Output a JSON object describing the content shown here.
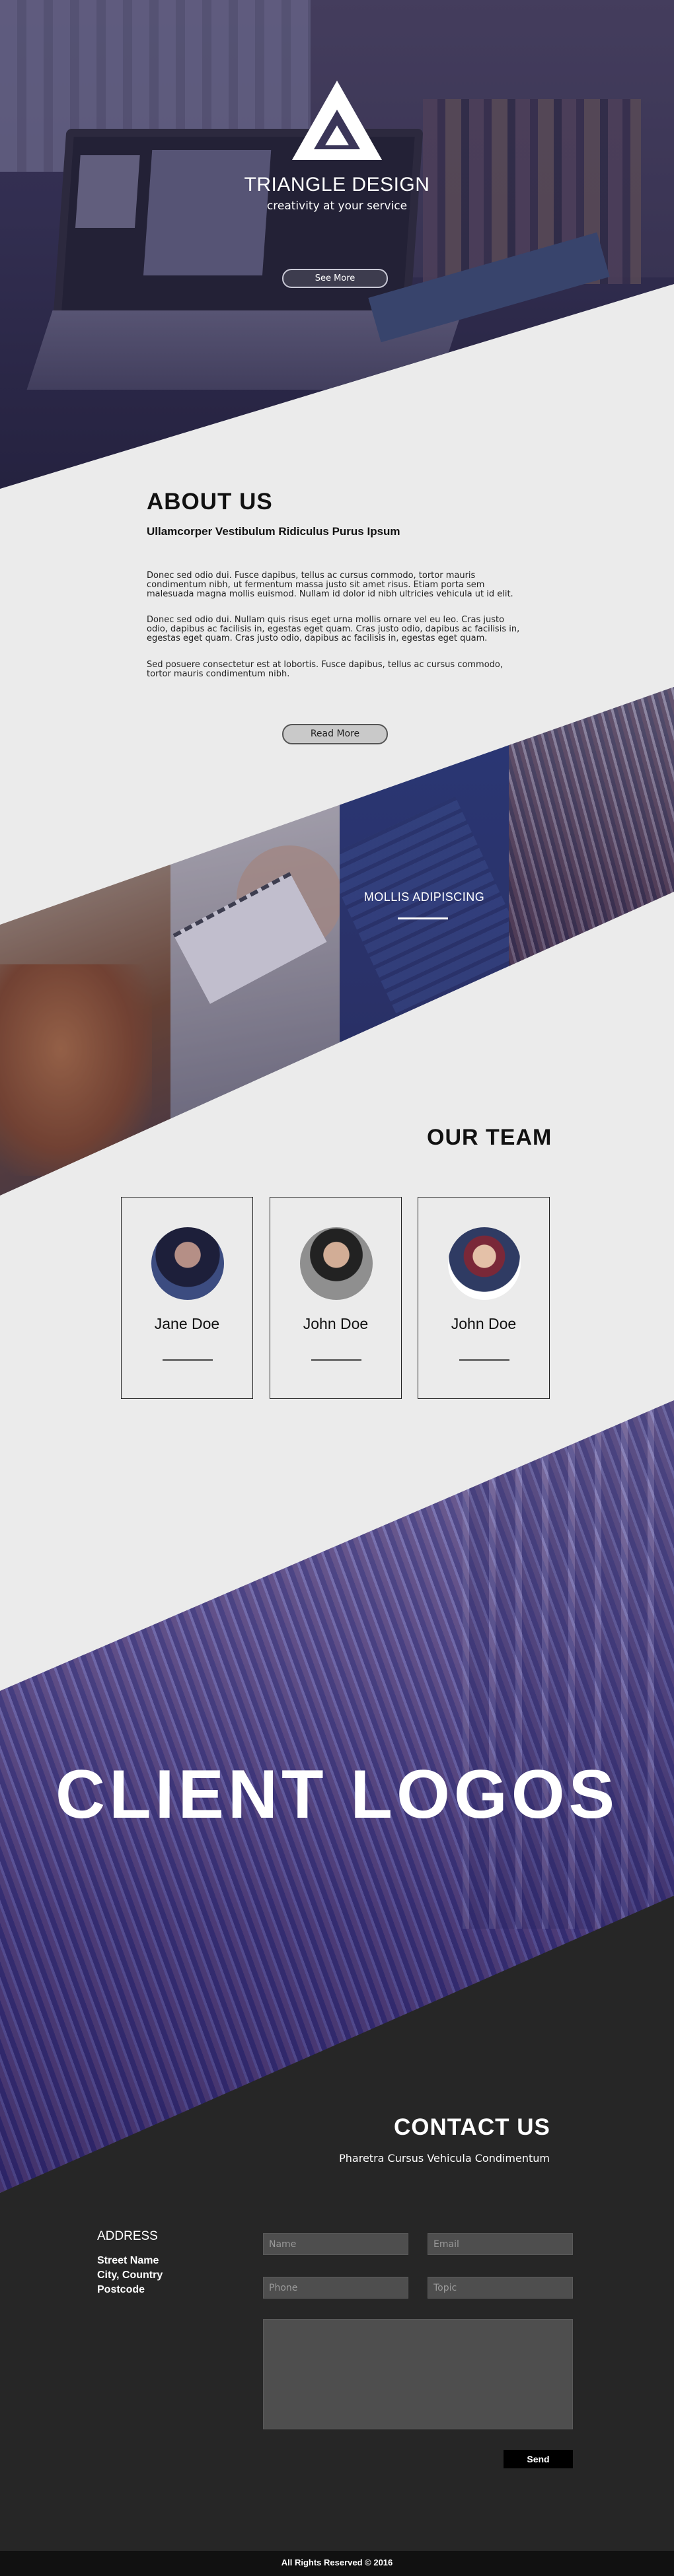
{
  "hero": {
    "brand_name": "TRIANGLE DESIGN",
    "tagline": "creativity at your service",
    "cta_label": "See More"
  },
  "about": {
    "title": "ABOUT US",
    "subtitle": "Ullamcorper Vestibulum Ridiculus Purus Ipsum",
    "paragraphs": [
      "Donec sed odio dui. Fusce dapibus, tellus ac cursus commodo, tortor mauris condimentum nibh, ut fermentum massa justo sit amet risus. Etiam porta sem malesuada magna mollis euismod. Nullam id dolor id nibh ultricies vehicula ut id elit.",
      "Donec sed odio dui. Nullam quis risus eget urna mollis ornare vel eu leo. Cras justo odio, dapibus ac facilisis in, egestas eget quam. Cras justo odio, dapibus ac facilisis in, egestas eget quam. Cras justo odio, dapibus ac facilisis in, egestas eget quam.",
      "Sed posuere consectetur est at lobortis. Fusce dapibus, tellus ac cursus commodo, tortor mauris condimentum nibh."
    ],
    "cta_label": "Read More"
  },
  "gallery": {
    "caption": "MOLLIS ADIPISCING"
  },
  "team": {
    "title": "OUR TEAM",
    "members": [
      {
        "name": "Jane Doe"
      },
      {
        "name": "John Doe"
      },
      {
        "name": "John Doe"
      }
    ]
  },
  "clients": {
    "title": "CLIENT LOGOS"
  },
  "contact": {
    "title": "CONTACT US",
    "subtitle": "Pharetra Cursus Vehicula Condimentum",
    "address_title": "ADDRESS",
    "address_lines": [
      "Street Name",
      "City, Country",
      "Postcode"
    ],
    "form": {
      "name_placeholder": "Name",
      "email_placeholder": "Email",
      "phone_placeholder": "Phone",
      "topic_placeholder": "Topic",
      "message_placeholder": "",
      "send_label": "Send"
    }
  },
  "footer": {
    "text": "All Rights Reserved © 2016"
  },
  "colors": {
    "accent_purple": "#3b3579",
    "dark_bg": "#262626",
    "light_bg": "#ebebeb"
  },
  "icons": {
    "logo": "triangle-logo-icon"
  }
}
